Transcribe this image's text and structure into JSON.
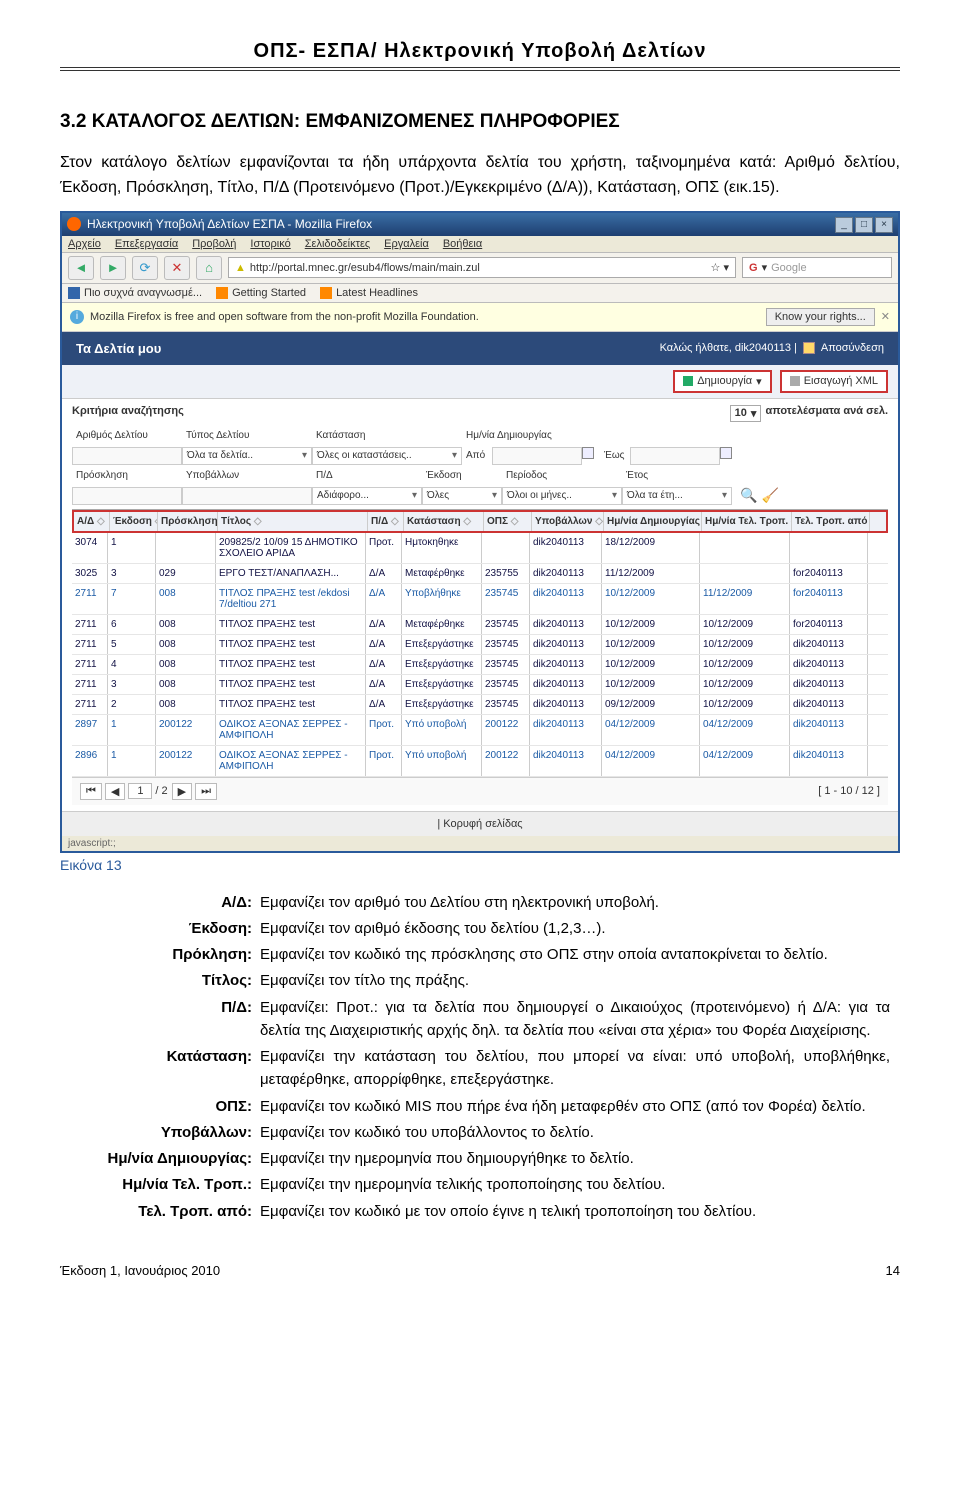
{
  "doc_header": "ΟΠΣ- ΕΣΠΑ/ Ηλεκτρονική Υποβολή Δελτίων",
  "section_title": "3.2 ΚΑΤΑΛΟΓΟΣ ΔΕΛΤΙΩΝ: ΕΜΦΑΝΙΖΟΜΕΝΕΣ ΠΛΗΡΟΦΟΡΙΕΣ",
  "intro": "Στον κατάλογο δελτίων εμφανίζονται τα ήδη υπάρχοντα δελτία του χρήστη, ταξινομημένα κατά: Αριθμό δελτίου, Έκδοση, Πρόσκληση, Τίτλο, Π/Δ (Προτεινόμενο (Προτ.)/Εγκεκριμένο (Δ/Α)), Κατάσταση, ΟΠΣ (εικ.15).",
  "caption": "Εικόνα 13",
  "browser": {
    "title": "Ηλεκτρονική Υποβολή Δελτίων ΕΣΠΑ - Mozilla Firefox",
    "menus": [
      "Αρχείο",
      "Επεξεργασία",
      "Προβολή",
      "Ιστορικό",
      "Σελιδοδείκτες",
      "Εργαλεία",
      "Βοήθεια"
    ],
    "url": "http://portal.mnec.gr/esub4/flows/main/main.zul",
    "search_engine": "G",
    "search_placeholder": "Google",
    "bookmarks": [
      "Πιο συχνά αναγνωσμέ...",
      "Getting Started",
      "Latest Headlines"
    ],
    "infobar": "Mozilla Firefox is free and open software from the non-profit Mozilla Foundation.",
    "know_btn": "Know your rights...",
    "status": "javascript:;"
  },
  "app": {
    "tab": "Τα Δελτία μου",
    "welcome": "Καλώς ήλθατε, dik2040113  |",
    "logout": "Αποσύνδεση",
    "create": "Δημιουργία",
    "import": "Εισαγωγή XML",
    "search_header": "Κριτήρια αναζήτησης",
    "results_per_page_value": "10",
    "results_per_page_label": "αποτελέσματα ανά σελ.",
    "filters": {
      "row1_labels": [
        "Αριθμός Δελτίου",
        "Τύπος Δελτίου",
        "Κατάσταση",
        "Ημ/νία Δημιουργίας"
      ],
      "row2_values": {
        "typos": "Όλα τα δελτία..",
        "katastasi": "Όλες οι καταστάσεις..",
        "apo": "Από",
        "eos": "Έως"
      },
      "row3_labels": [
        "Πρόσκληση",
        "Υποβάλλων",
        "Π/Δ",
        "Έκδοση",
        "Περίοδος",
        "Έτος"
      ],
      "row4_values": {
        "pd": "Αδιάφορο...",
        "ekd": "Όλες",
        "per": "Όλοι οι μήνες..",
        "etos": "Όλα τα έτη..."
      }
    },
    "grid_headers": [
      "Α/Δ",
      "Έκδοση",
      "Πρόσκληση",
      "Τίτλος",
      "Π/Δ",
      "Κατάσταση",
      "ΟΠΣ",
      "Υποβάλλων",
      "Ημ/νία Δημιουργίας",
      "Ημ/νία Τελ. Τροπ.",
      "Τελ. Τροπ. από"
    ],
    "rows": [
      {
        "aa": "3074",
        "ekd": "1",
        "pro": "",
        "tit": "209825/2 10/09 15 ΔΗΜΟΤΙΚΟ ΣΧΟΛΕΙΟ ΑΡΙΔΑ",
        "pd": "Προτ.",
        "kat": "Ημτοκηθηκε",
        "ops": "",
        "ypo": "dik2040113",
        "dim": "18/12/2009",
        "tel": "",
        "apo": ""
      },
      {
        "aa": "3025",
        "ekd": "3",
        "pro": "029",
        "tit": "ΕΡΓΟ ΤΕΣΤ/ΑΝΑΠΛΑΣΗ...",
        "pd": "Δ/Α",
        "kat": "Μεταφέρθηκε",
        "ops": "235755",
        "ypo": "dik2040113",
        "dim": "11/12/2009",
        "tel": "",
        "apo": "for2040113"
      },
      {
        "aa": "2711",
        "ekd": "7",
        "pro": "008",
        "tit": "ΤΙΤΛΟΣ ΠΡΑΞΗΣ test /ekdosi 7/deltiou 271",
        "pd": "Δ/Α",
        "kat": "Υποβλήθηκε",
        "ops": "235745",
        "ypo": "dik2040113",
        "dim": "10/12/2009",
        "tel": "11/12/2009",
        "apo": "for2040113",
        "hl": true
      },
      {
        "aa": "2711",
        "ekd": "6",
        "pro": "008",
        "tit": "ΤΙΤΛΟΣ ΠΡΑΞΗΣ test",
        "pd": "Δ/Α",
        "kat": "Μεταφέρθηκε",
        "ops": "235745",
        "ypo": "dik2040113",
        "dim": "10/12/2009",
        "tel": "10/12/2009",
        "apo": "for2040113"
      },
      {
        "aa": "2711",
        "ekd": "5",
        "pro": "008",
        "tit": "ΤΙΤΛΟΣ ΠΡΑΞΗΣ test",
        "pd": "Δ/Α",
        "kat": "Επεξεργάστηκε",
        "ops": "235745",
        "ypo": "dik2040113",
        "dim": "10/12/2009",
        "tel": "10/12/2009",
        "apo": "dik2040113"
      },
      {
        "aa": "2711",
        "ekd": "4",
        "pro": "008",
        "tit": "ΤΙΤΛΟΣ ΠΡΑΞΗΣ test",
        "pd": "Δ/Α",
        "kat": "Επεξεργάστηκε",
        "ops": "235745",
        "ypo": "dik2040113",
        "dim": "10/12/2009",
        "tel": "10/12/2009",
        "apo": "dik2040113"
      },
      {
        "aa": "2711",
        "ekd": "3",
        "pro": "008",
        "tit": "ΤΙΤΛΟΣ ΠΡΑΞΗΣ test",
        "pd": "Δ/Α",
        "kat": "Επεξεργάστηκε",
        "ops": "235745",
        "ypo": "dik2040113",
        "dim": "10/12/2009",
        "tel": "10/12/2009",
        "apo": "dik2040113"
      },
      {
        "aa": "2711",
        "ekd": "2",
        "pro": "008",
        "tit": "ΤΙΤΛΟΣ ΠΡΑΞΗΣ test",
        "pd": "Δ/Α",
        "kat": "Επεξεργάστηκε",
        "ops": "235745",
        "ypo": "dik2040113",
        "dim": "09/12/2009",
        "tel": "10/12/2009",
        "apo": "dik2040113"
      },
      {
        "aa": "2897",
        "ekd": "1",
        "pro": "200122",
        "tit": "ΟΔΙΚΟΣ ΑΞΟΝΑΣ ΣΕΡΡΕΣ - ΑΜΦΙΠΟΛΗ",
        "pd": "Προτ.",
        "kat": "Υπό υποβολή",
        "ops": "200122",
        "ypo": "dik2040113",
        "dim": "04/12/2009",
        "tel": "04/12/2009",
        "apo": "dik2040113",
        "hl": true
      },
      {
        "aa": "2896",
        "ekd": "1",
        "pro": "200122",
        "tit": "ΟΔΙΚΟΣ ΑΞΟΝΑΣ ΣΕΡΡΕΣ - ΑΜΦΙΠΟΛΗ",
        "pd": "Προτ.",
        "kat": "Υπό υποβολή",
        "ops": "200122",
        "ypo": "dik2040113",
        "dim": "04/12/2009",
        "tel": "04/12/2009",
        "apo": "dik2040113",
        "hl": true
      }
    ],
    "paginator": {
      "page": "1",
      "total": "/ 2",
      "count": "[ 1 - 10 / 12 ]"
    },
    "footer": "| Κορυφή σελίδας"
  },
  "desc": [
    {
      "k": "Α/Δ:",
      "v": "Εμφανίζει τον αριθμό του Δελτίου στη ηλεκτρονική υποβολή."
    },
    {
      "k": "Έκδοση:",
      "v": "Εμφανίζει τον αριθμό έκδοσης του δελτίου (1,2,3…)."
    },
    {
      "k": "Πρόκληση:",
      "v": "Εμφανίζει τον κωδικό της πρόσκλησης στο ΟΠΣ στην οποία ανταποκρίνεται το δελτίο."
    },
    {
      "k": "Τίτλος:",
      "v": "Εμφανίζει τον τίτλο της πράξης."
    },
    {
      "k": "Π/Δ:",
      "v": "Εμφανίζει: Προτ.: για τα δελτία που δημιουργεί ο Δικαιούχος (προτεινόμενο) ή Δ/Α: για τα δελτία της Διαχειριστικής αρχής δηλ. τα δελτία που «είναι στα χέρια» του Φορέα Διαχείρισης."
    },
    {
      "k": "Κατάσταση:",
      "v": "Εμφανίζει την κατάσταση του δελτίου, που μπορεί να είναι: υπό υποβολή, υποβλήθηκε, μεταφέρθηκε, απορρίφθηκε, επεξεργάστηκε."
    },
    {
      "k": "ΟΠΣ:",
      "v": "Εμφανίζει τον κωδικό MIS που πήρε ένα ήδη μεταφερθέν στο ΟΠΣ (από τον Φορέα) δελτίο."
    },
    {
      "k": "Υποβάλλων:",
      "v": "Εμφανίζει τον κωδικό του υποβάλλοντος το δελτίο."
    },
    {
      "k": "Ημ/νία Δημιουργίας:",
      "v": "Εμφανίζει την ημερομηνία που δημιουργήθηκε το δελτίο."
    },
    {
      "k": "Ημ/νία Τελ. Τροπ.:",
      "v": "Εμφανίζει την ημερομηνία τελικής τροποποίησης του δελτίου."
    },
    {
      "k": "Τελ. Τροπ. από:",
      "v": "Εμφανίζει τον κωδικό με τον οποίο έγινε η τελική τροποποίηση του δελτίου."
    }
  ],
  "footer": {
    "left": "Έκδοση 1, Ιανουάριος 2010",
    "right": "14"
  }
}
